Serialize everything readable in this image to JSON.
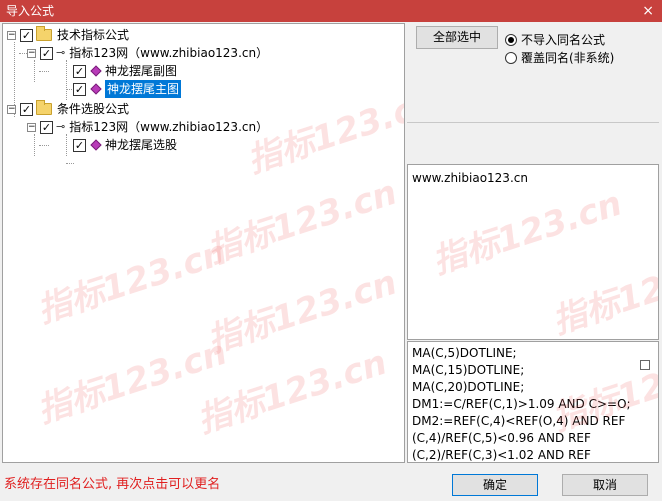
{
  "window": {
    "title": "导入公式",
    "close_glyph": "×"
  },
  "tree": {
    "groups": [
      {
        "label": "技术指标公式",
        "source": "指标123网（www.zhibiao123.cn）",
        "items": [
          "神龙摆尾副图",
          "神龙摆尾主图"
        ]
      },
      {
        "label": "条件选股公式",
        "source": "指标123网（www.zhibiao123.cn）",
        "items": [
          "神龙摆尾选股"
        ]
      }
    ]
  },
  "watermark": {
    "text": "指标123.cn"
  },
  "buttons": {
    "select_all": "全部选中",
    "ok": "确定",
    "cancel": "取消"
  },
  "options": {
    "no_import_same": "不导入同名公式",
    "overwrite_same": "覆盖同名(非系统)"
  },
  "info": {
    "url": "www.zhibiao123.cn"
  },
  "formula": {
    "lines": [
      "MA(C,5)DOTLINE;",
      "MA(C,15)DOTLINE;",
      "MA(C,20)DOTLINE;",
      "DM1:=C/REF(C,1)>1.09 AND C>=O;",
      "DM2:=REF(C,4)<REF(O,4) AND REF",
      "(C,4)/REF(C,5)<0.96 AND REF",
      "(C,2)/REF(C,3)<1.02 AND REF"
    ]
  },
  "status": {
    "message": "系统存在同名公式, 再次点击可以更名"
  }
}
